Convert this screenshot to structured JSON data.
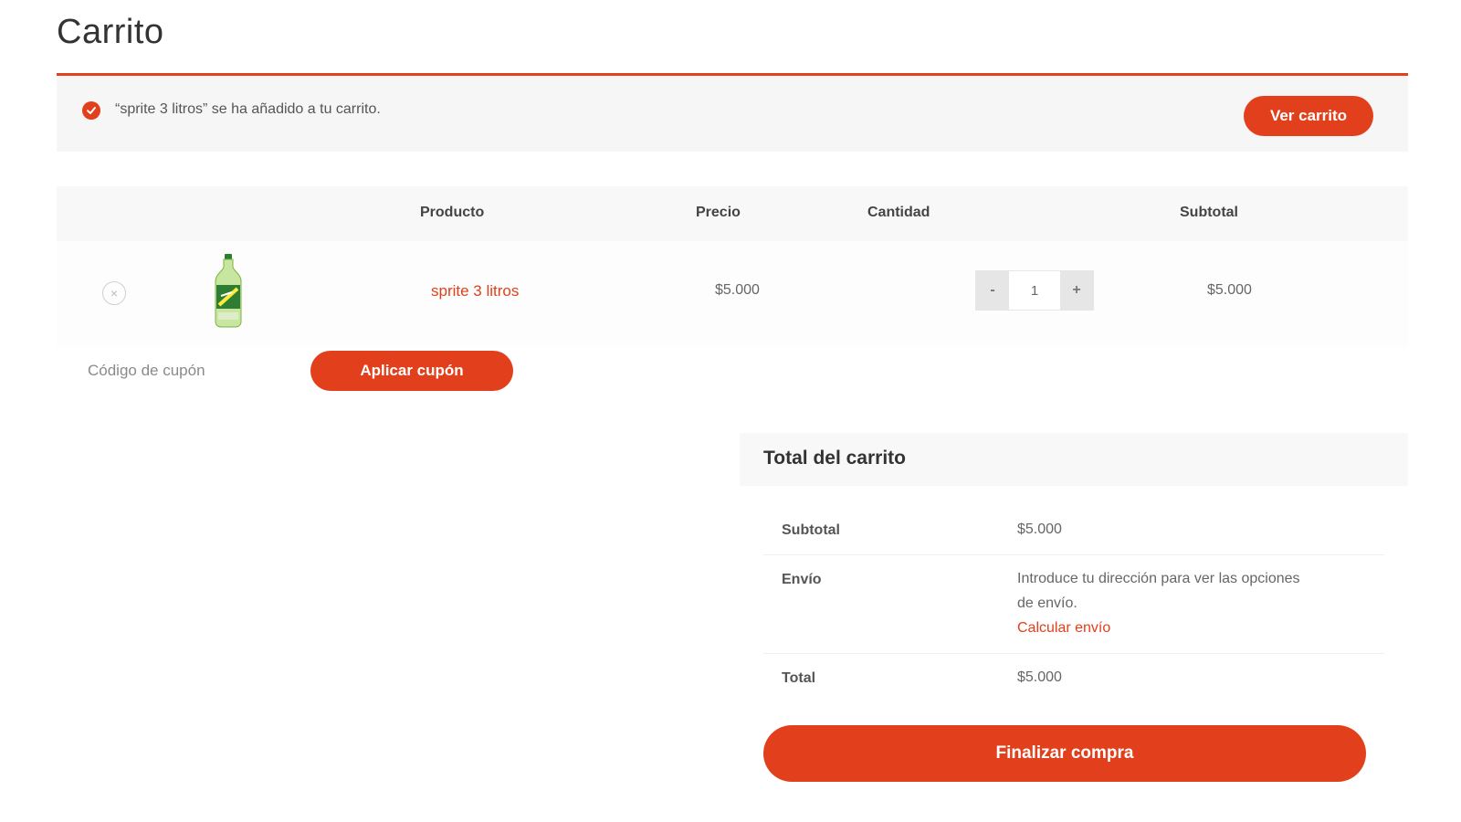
{
  "page": {
    "title": "Carrito"
  },
  "notice": {
    "message": "“sprite 3 litros” se ha añadido a tu carrito.",
    "view_cart_label": "Ver carrito",
    "accent_color": "#e2401c"
  },
  "cart": {
    "columns": [
      "Producto",
      "Precio",
      "Cantidad",
      "Subtotal"
    ],
    "items": [
      {
        "name": "sprite 3 litros",
        "price": "$5.000",
        "quantity": "1",
        "subtotal": "$5.000",
        "image_icon": "soda-bottle-icon"
      }
    ],
    "qty_minus": "-",
    "qty_plus": "+",
    "coupon_placeholder": "Código de cupón",
    "apply_coupon_label": "Aplicar cupón"
  },
  "totals": {
    "title": "Total del carrito",
    "subtotal_label": "Subtotal",
    "subtotal_value": "$5.000",
    "shipping_label": "Envío",
    "shipping_text_1": "Introduce tu dirección para ver las opciones",
    "shipping_text_2": "de envío.",
    "shipping_link": "Calcular envío",
    "total_label": "Total",
    "total_value": "$5.000",
    "checkout_label": "Finalizar compra"
  }
}
